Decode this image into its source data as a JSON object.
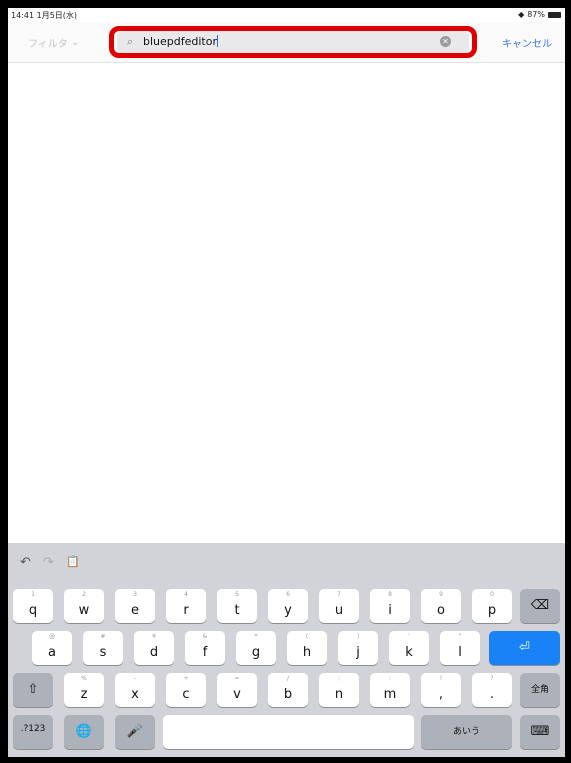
{
  "status": {
    "time": "14:41",
    "date": "1月5日(水)",
    "battery": "87%"
  },
  "nav": {
    "filter_label": "フィルタ",
    "search_value": "bluepdfeditor",
    "cancel_label": "キャンセル"
  },
  "keyboard": {
    "toolbar": {
      "undo": "↶",
      "redo": "↷",
      "paste": "📋"
    },
    "row1": [
      {
        "sub": "1",
        "main": "q"
      },
      {
        "sub": "2",
        "main": "w"
      },
      {
        "sub": "3",
        "main": "e"
      },
      {
        "sub": "4",
        "main": "r"
      },
      {
        "sub": "5",
        "main": "t"
      },
      {
        "sub": "6",
        "main": "y"
      },
      {
        "sub": "7",
        "main": "u"
      },
      {
        "sub": "8",
        "main": "i"
      },
      {
        "sub": "9",
        "main": "o"
      },
      {
        "sub": "0",
        "main": "p"
      }
    ],
    "row2": [
      {
        "sub": "@",
        "main": "a"
      },
      {
        "sub": "#",
        "main": "s"
      },
      {
        "sub": "¥",
        "main": "d"
      },
      {
        "sub": "&",
        "main": "f"
      },
      {
        "sub": "*",
        "main": "g"
      },
      {
        "sub": "(",
        "main": "h"
      },
      {
        "sub": ")",
        "main": "j"
      },
      {
        "sub": "'",
        "main": "k"
      },
      {
        "sub": "\"",
        "main": "l"
      }
    ],
    "row3": [
      {
        "sub": "%",
        "main": "z"
      },
      {
        "sub": "-",
        "main": "x"
      },
      {
        "sub": "+",
        "main": "c"
      },
      {
        "sub": "=",
        "main": "v"
      },
      {
        "sub": "/",
        "main": "b"
      },
      {
        "sub": ";",
        "main": "n"
      },
      {
        "sub": ":",
        "main": "m"
      },
      {
        "sub": "!",
        "main": ","
      },
      {
        "sub": "?",
        "main": "."
      }
    ],
    "backspace": "⌫",
    "return": "⏎",
    "shift": "⇧",
    "zenkaku": "全角",
    "numbers": ".?123",
    "globe": "🌐",
    "mic": "🎤",
    "kana": "あいう",
    "hide": "⌨"
  }
}
